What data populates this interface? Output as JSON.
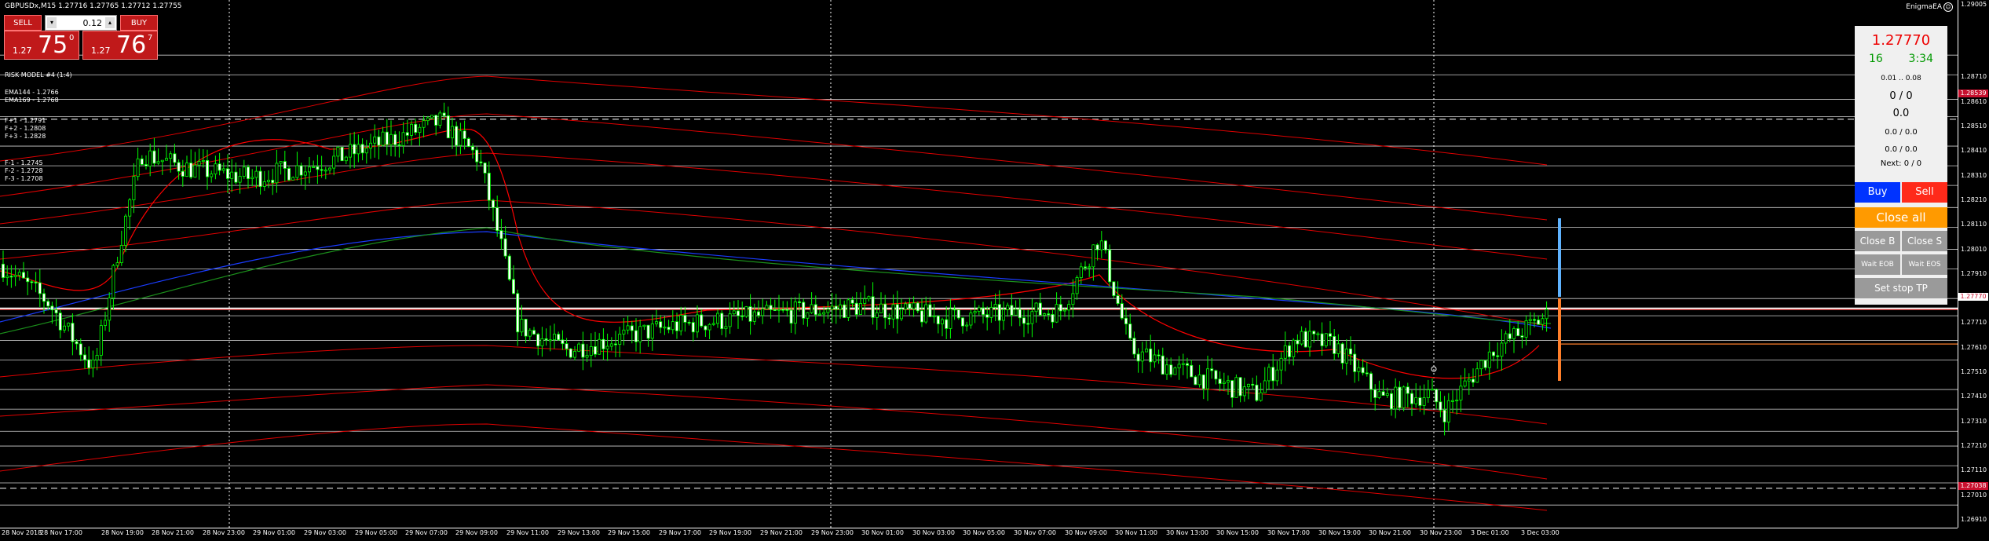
{
  "window": {
    "title": "GBPUSDx,M15  1.27716 1.27765 1.27712 1.27755",
    "ea_label": "EnigmaEA",
    "ea_icon": "smiley-icon"
  },
  "one_click": {
    "sell_label": "SELL",
    "buy_label": "BUY",
    "lot": "0.12",
    "bid_small": "1.27",
    "bid_big": "75",
    "bid_sup": "0",
    "ask_small": "1.27",
    "ask_big": "76",
    "ask_sup": "7"
  },
  "info": {
    "risk_model": "RISK MODEL #4 (1:4)",
    "ema144": "EMA144 - 1.2766",
    "ema169": "EMA169 - 1.2768",
    "fib_up": [
      "F+1 - 1.2791",
      "F+2 - 1.2808",
      "F+3 - 1.2828"
    ],
    "fib_down": [
      "F-1 - 1.2745",
      "F-2 - 1.2728",
      "F-3 - 1.2708"
    ]
  },
  "ea_panel": {
    "price": "1.27770",
    "spread": "16",
    "timer": "3:34",
    "lot_range": "0.01 .. 0.08",
    "orders": "0 / 0",
    "profit": "0.0",
    "pnl": "0.0 / 0.0",
    "pnl2": "0.0 / 0.0",
    "next": "Next: 0 / 0",
    "buy_label": "Buy",
    "sell_label": "Sell",
    "close_all_label": "Close all",
    "close_b_label": "Close B",
    "close_s_label": "Close S",
    "wait_eob_label": "Wait EOB",
    "wait_eos_label": "Wait EOS",
    "set_stop_label": "Set stop TP",
    "colors": {
      "buy": "#0033ff",
      "sell": "#ff2a1a",
      "close_all": "#ff9a00"
    }
  },
  "price_axis": [
    "1.29005",
    "1.28710",
    "1.28610",
    "1.28510",
    "1.28410",
    "1.28310",
    "1.28210",
    "1.28110",
    "1.28010",
    "1.27910",
    "1.27810",
    "1.27710",
    "1.27610",
    "1.27510",
    "1.27410",
    "1.27310",
    "1.27210",
    "1.27110",
    "1.27010",
    "1.26910"
  ],
  "price_markers": {
    "current": "1.27770",
    "upper_red": "1.28539",
    "lower_red": "1.27038"
  },
  "time_axis": [
    "28 Nov 2018",
    "28 Nov 17:00",
    "28 Nov 19:00",
    "28 Nov 21:00",
    "28 Nov 23:00",
    "29 Nov 01:00",
    "29 Nov 03:00",
    "29 Nov 05:00",
    "29 Nov 07:00",
    "29 Nov 09:00",
    "29 Nov 11:00",
    "29 Nov 13:00",
    "29 Nov 15:00",
    "29 Nov 17:00",
    "29 Nov 19:00",
    "29 Nov 21:00",
    "29 Nov 23:00",
    "30 Nov 01:00",
    "30 Nov 03:00",
    "30 Nov 05:00",
    "30 Nov 07:00",
    "30 Nov 09:00",
    "30 Nov 11:00",
    "30 Nov 13:00",
    "30 Nov 15:00",
    "30 Nov 17:00",
    "30 Nov 19:00",
    "30 Nov 21:00",
    "30 Nov 23:00",
    "3 Dec 01:00",
    "3 Dec 03:00"
  ],
  "colors": {
    "candles": "#00ff00",
    "ma_red": "#ff0000",
    "ma_blue": "#1a3cff",
    "ma_green": "#1b8f1b",
    "grid": "#ffffff"
  }
}
